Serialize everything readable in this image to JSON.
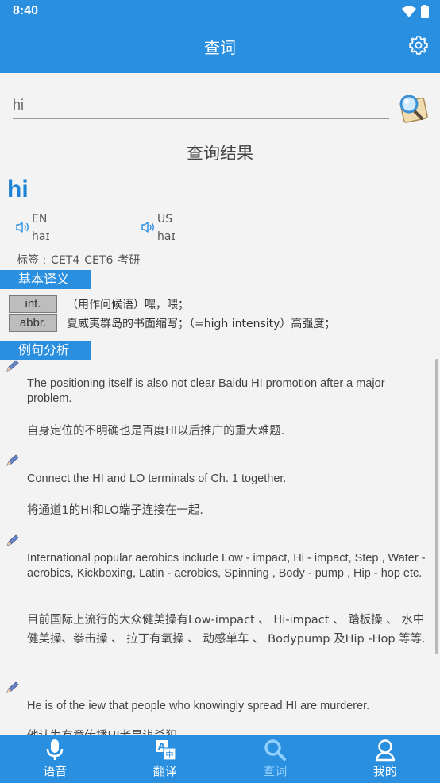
{
  "status": {
    "time": "8:40"
  },
  "header": {
    "title": "查词"
  },
  "search": {
    "value": "hi"
  },
  "result": {
    "heading": "查询结果",
    "word": "hi",
    "pron": [
      {
        "label": "EN",
        "phonetic": "haɪ"
      },
      {
        "label": "US",
        "phonetic": "haɪ"
      }
    ],
    "tags_label": "标签 :",
    "tags": [
      "CET4",
      "CET6",
      "考研"
    ],
    "basic_title": "基本译义",
    "definitions": [
      {
        "pos": "int.",
        "text": "（用作问候语）嘿，喂；"
      },
      {
        "pos": "abbr.",
        "text": "夏威夷群岛的书面缩写；（=high intensity）高强度；"
      }
    ],
    "examples_title": "例句分析",
    "examples": [
      {
        "en": "The positioning itself is also not clear Baidu HI promotion after a major problem.",
        "cn": "自身定位的不明确也是百度HI以后推广的重大难题."
      },
      {
        "en": "Connect the HI and LO terminals of Ch. 1 together.",
        "cn": "将通道1的HI和LO端子连接在一起."
      },
      {
        "en": "International popular aerobics include Low - impact, Hi - impact, Step , Water - aerobics, Kickboxing, Latin - aerobics, Spinning , Body - pump , Hip - hop etc.",
        "cn": "目前国际上流行的大众健美操有Low-impact 、 Hi-impact 、 踏板操 、 水中健美操、拳击操 、 拉丁有氧操 、 动感单车 、 Bodypump 及Hip -Hop 等等."
      },
      {
        "en": "He is of the iew that people who knowingly spread HI are murderer.",
        "cn": "他认为有意传播HI者是谋杀犯."
      }
    ]
  },
  "nav": [
    {
      "label": "语音",
      "icon": "microphone-icon"
    },
    {
      "label": "翻译",
      "icon": "translate-icon"
    },
    {
      "label": "查词",
      "icon": "search-icon"
    },
    {
      "label": "我的",
      "icon": "profile-icon"
    }
  ],
  "colors": {
    "primary": "#2b8fe0",
    "word": "#1e83d6",
    "active_nav": "#8fd0ff"
  }
}
